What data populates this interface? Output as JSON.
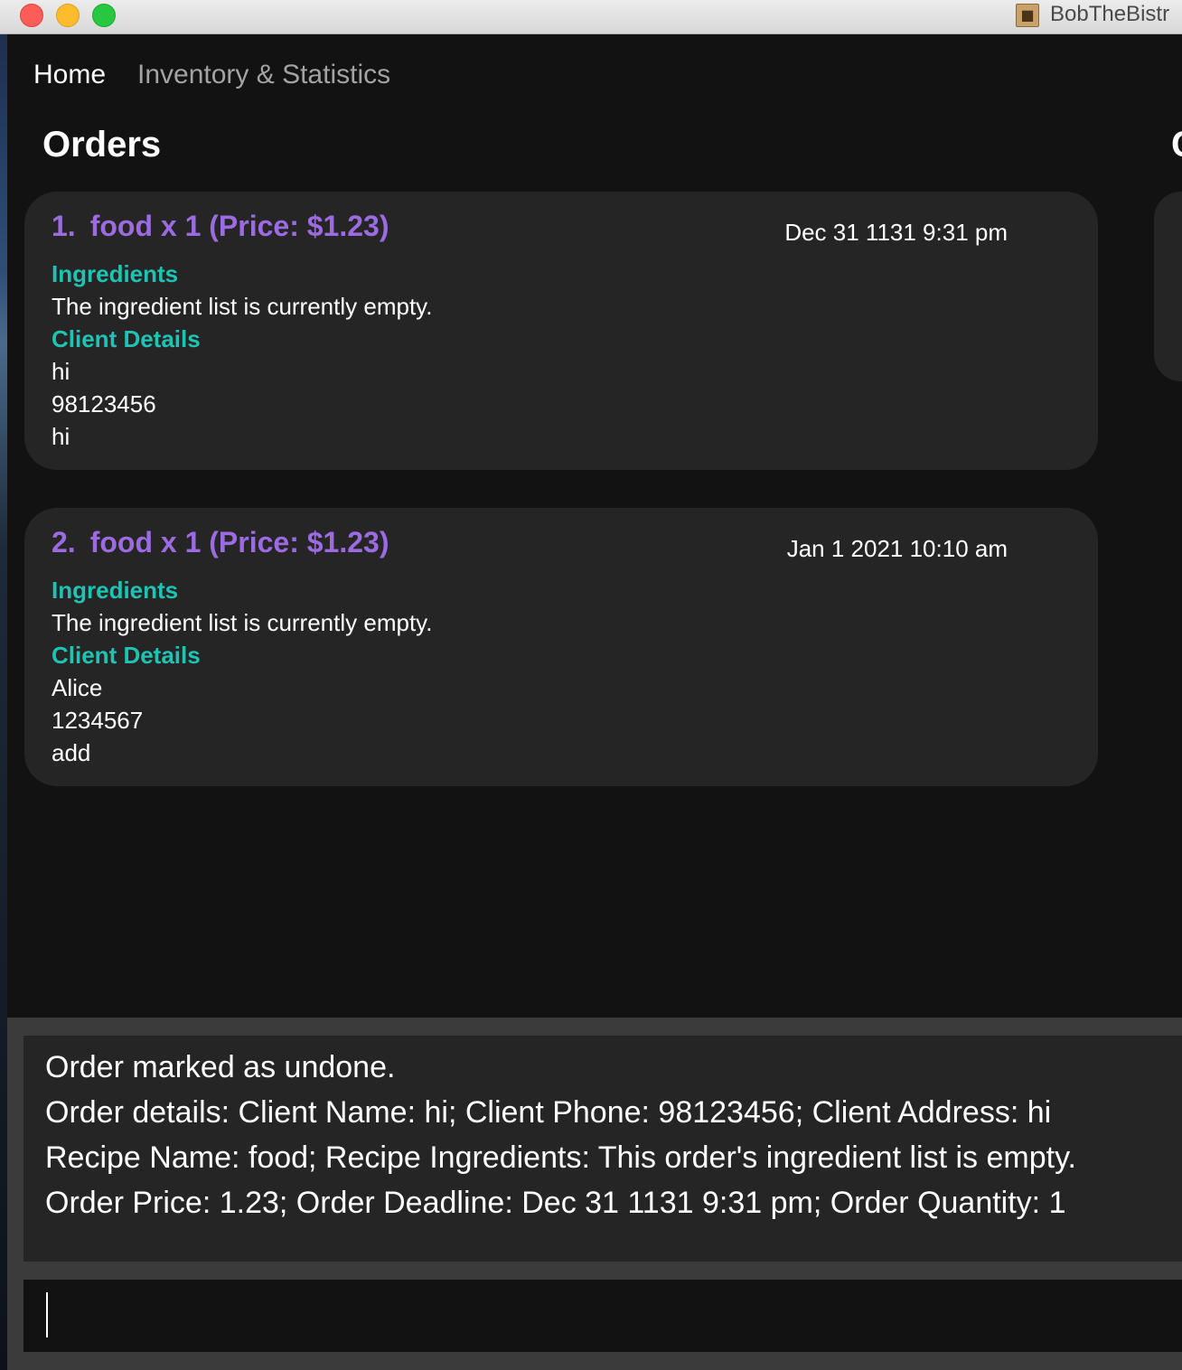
{
  "window": {
    "title": "BobTheBistr",
    "icon": "person-card-icon"
  },
  "nav": {
    "tabs": [
      "Home",
      "Inventory & Statistics"
    ],
    "active": "Home"
  },
  "orders_section": {
    "title": "Orders",
    "orders": [
      {
        "index": "1.",
        "title": "food x 1 (Price: $1.23)",
        "deadline": "Dec 31 1131 9:31 pm",
        "ingredients_heading": "Ingredients",
        "ingredients_text": "The ingredient list is currently empty.",
        "client_heading": "Client Details",
        "client_name": "hi",
        "client_phone": "98123456",
        "client_address": "hi"
      },
      {
        "index": "2.",
        "title": "food x 1 (Price: $1.23)",
        "deadline": "Jan 1 2021 10:10 am",
        "ingredients_heading": "Ingredients",
        "ingredients_text": "The ingredient list is currently empty.",
        "client_heading": "Client Details",
        "client_name": "Alice",
        "client_phone": "1234567",
        "client_address": "add"
      }
    ]
  },
  "second_section": {
    "title_fragment": "C"
  },
  "result": {
    "lines": [
      "Order marked as undone.",
      "Order details: Client Name: hi; Client Phone: 98123456; Client Address: hi",
      "Recipe Name: food; Recipe Ingredients: This order's ingredient list is empty.",
      "Order Price: 1.23; Order Deadline: Dec 31 1131 9:31 pm; Order Quantity: 1"
    ]
  },
  "command": {
    "value": ""
  },
  "colors": {
    "accent_purple": "#9c6be2",
    "accent_teal": "#1ec3b3",
    "background": "#121212",
    "card": "#252525"
  }
}
